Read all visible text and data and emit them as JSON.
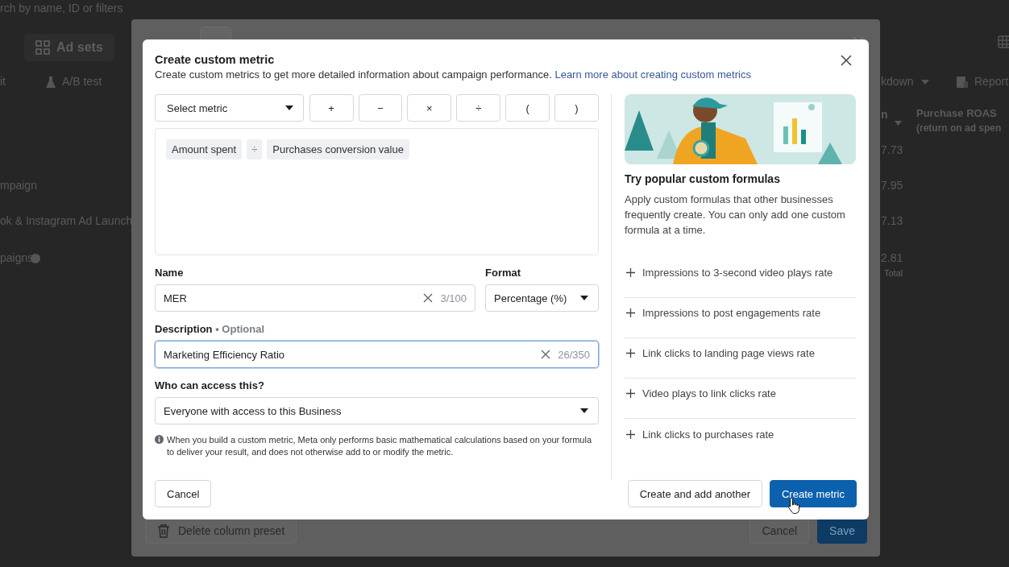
{
  "background_page": {
    "search_placeholder": "rch by name, ID or filters",
    "tab": "Ad sets",
    "toolbar_left": [
      "it",
      "A/B test"
    ],
    "toolbar_right": [
      "kdown",
      "Report"
    ],
    "rows": [
      "mpaign",
      "ok & Instagram Ad Launch",
      "paigns"
    ],
    "column_headers": [
      "n",
      "Purchase ROAS",
      "(return on ad spen"
    ],
    "values": [
      "7.73",
      "7.95",
      "7.13",
      "2.81"
    ],
    "value_note": "Total"
  },
  "preset_dialog": {
    "delete_button": "Delete column preset",
    "cancel": "Cancel",
    "save": "Save"
  },
  "modal": {
    "title": "Create custom metric",
    "subtitle": "Create custom metrics to get more detailed information about campaign performance.",
    "link": "Learn more about creating custom metrics",
    "select_metric": {
      "placeholder": "Select metric"
    },
    "operators": [
      "+",
      "−",
      "×",
      "÷",
      "(",
      ")"
    ],
    "formula": [
      {
        "kind": "metric",
        "label": "Amount spent"
      },
      {
        "kind": "operator",
        "label": "÷"
      },
      {
        "kind": "metric",
        "label": "Purchases conversion value"
      }
    ],
    "name": {
      "label": "Name",
      "value": "MER",
      "counter": "3/100",
      "focused": false
    },
    "format": {
      "label": "Format",
      "value": "Percentage (%)"
    },
    "description": {
      "label": "Description",
      "separator": "•",
      "optional": "Optional",
      "value": "Marketing Efficiency Ratio",
      "counter": "26/350",
      "focused": true
    },
    "access": {
      "label": "Who can access this?",
      "value": "Everyone with access to this Business"
    },
    "note": "When you build a custom metric, Meta only performs basic mathematical calculations based on your formula to deliver your result, and does not otherwise add to or modify the metric.",
    "cancel": "Cancel",
    "secondary": "Create and add another",
    "primary": "Create metric",
    "sidebar": {
      "title": "Try popular custom formulas",
      "text": "Apply custom formulas that other businesses frequently create. You can only add one custom formula at a time.",
      "formulas": [
        "Impressions to 3-second video plays rate",
        "Impressions to post engagements rate",
        "Link clicks to landing page views rate",
        "Video plays to link clicks rate",
        "Link clicks to purchases rate"
      ]
    }
  }
}
